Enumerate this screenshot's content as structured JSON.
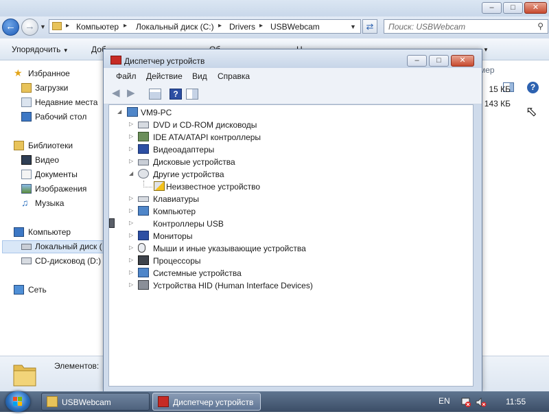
{
  "explorer": {
    "window_buttons": [
      "minimize",
      "maximize",
      "close"
    ],
    "breadcrumb": [
      "Компьютер",
      "Локальный диск (C:)",
      "Drivers",
      "USBWebcam"
    ],
    "search_placeholder": "Поиск: USBWebcam",
    "toolbar": {
      "organize": "Упорядочить",
      "add_fragment": "Доб",
      "view_fragment": "Об",
      "more_fragment": "Н"
    },
    "nav": {
      "favorites": "Избранное",
      "downloads": "Загрузки",
      "recent": "Недавние места",
      "desktop": "Рабочий стол",
      "libraries": "Библиотеки",
      "video": "Видео",
      "documents": "Документы",
      "pictures": "Изображения",
      "music": "Музыка",
      "computer": "Компьютер",
      "local_disk": "Локальный диск (",
      "cd_drive": "CD-дисковод (D:) ",
      "network": "Сеть"
    },
    "column_header_fragment": "мер",
    "file_sizes": [
      "15 КБ",
      "143 КБ"
    ],
    "status_text": "Элементов: "
  },
  "device_manager": {
    "title": "Диспетчер устройств",
    "menu": [
      "Файл",
      "Действие",
      "Вид",
      "Справка"
    ],
    "tree": {
      "root": "VM9-PC",
      "nodes": [
        {
          "label": "DVD и CD-ROM дисководы",
          "icon": "dvd-drive-icon",
          "expanded": false
        },
        {
          "label": "IDE ATA/ATAPI контроллеры",
          "icon": "ide-controller-icon",
          "expanded": false
        },
        {
          "label": "Видеоадаптеры",
          "icon": "display-adapter-icon",
          "expanded": false
        },
        {
          "label": "Дисковые устройства",
          "icon": "disk-drive-icon",
          "expanded": false
        },
        {
          "label": "Другие устройства",
          "icon": "other-devices-icon",
          "expanded": true
        },
        {
          "label": "Неизвестное устройство",
          "icon": "unknown-device-warning-icon",
          "child": true
        },
        {
          "label": "Клавиатуры",
          "icon": "keyboard-icon",
          "expanded": false
        },
        {
          "label": "Компьютер",
          "icon": "computer-icon",
          "expanded": false
        },
        {
          "label": "Контроллеры USB",
          "icon": "usb-controller-icon",
          "expanded": false
        },
        {
          "label": "Мониторы",
          "icon": "monitor-icon",
          "expanded": false
        },
        {
          "label": "Мыши и иные указывающие устройства",
          "icon": "mouse-icon",
          "expanded": false
        },
        {
          "label": "Процессоры",
          "icon": "processor-icon",
          "expanded": false
        },
        {
          "label": "Системные устройства",
          "icon": "system-devices-icon",
          "expanded": false
        },
        {
          "label": "Устройства HID (Human Interface Devices)",
          "icon": "hid-device-icon",
          "expanded": false
        }
      ]
    }
  },
  "taskbar": {
    "items": [
      "USBWebcam",
      "Диспетчер устройств"
    ],
    "language": "EN",
    "clock": "11:55"
  },
  "colors": {
    "accent": "#2a6fbf",
    "taskbar": "#4a5e78",
    "close_red": "#c74a2f"
  }
}
